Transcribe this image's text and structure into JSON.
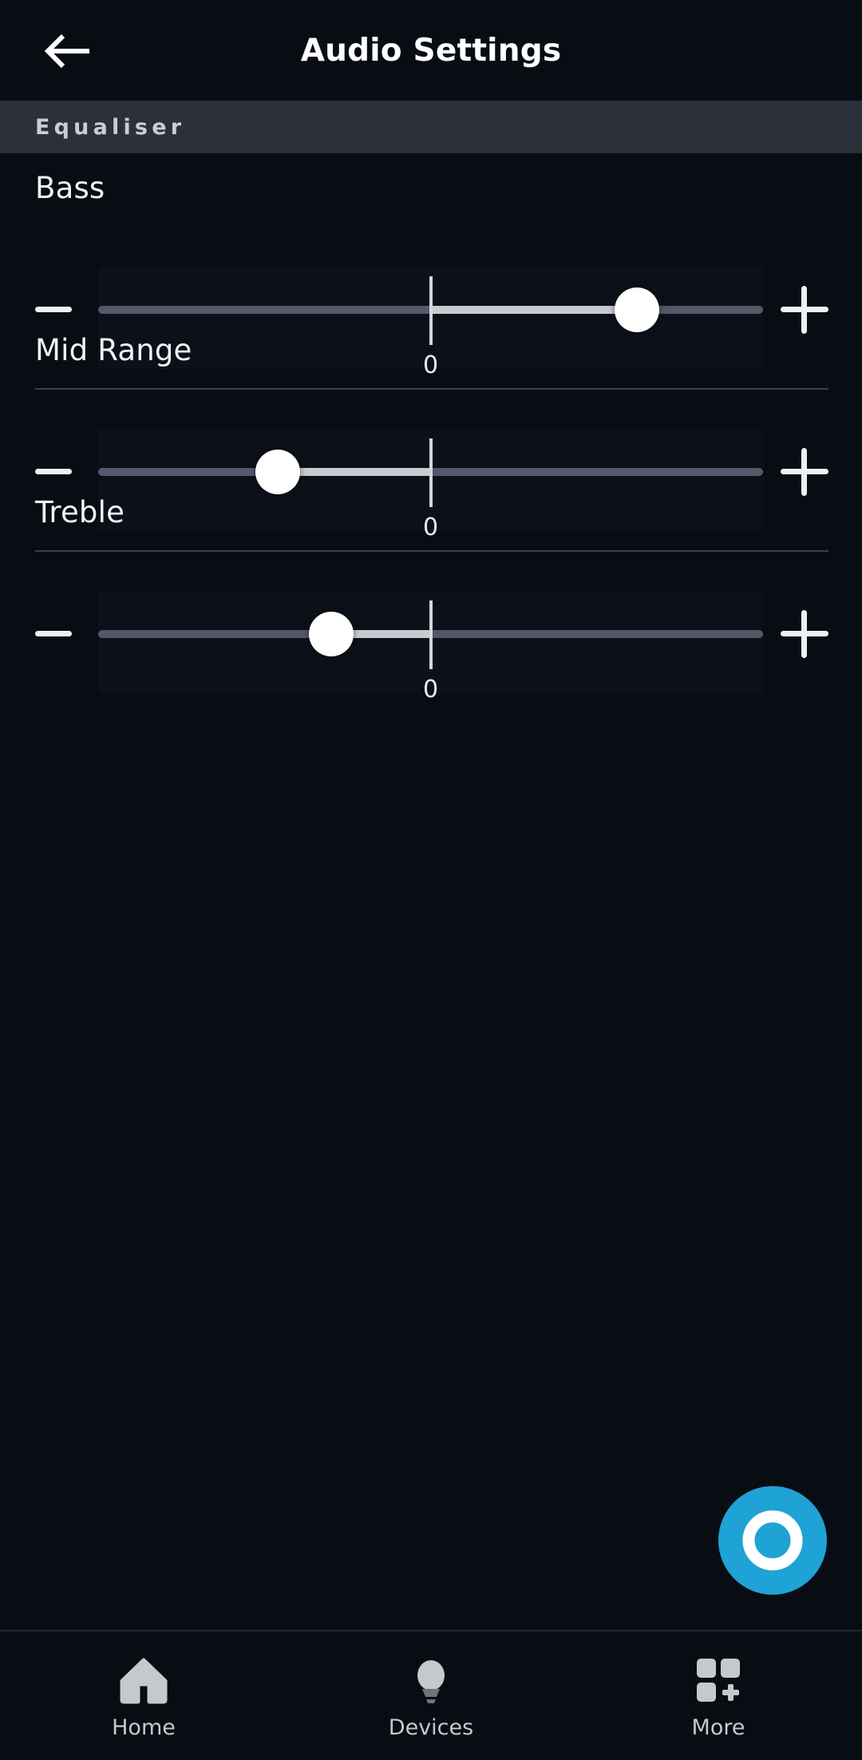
{
  "appbar": {
    "title": "Audio Settings",
    "back_icon": "arrow-left-icon"
  },
  "section": {
    "label": "Equaliser"
  },
  "equalizer": {
    "decrease_icon": "minus-icon",
    "increase_icon": "plus-icon",
    "bands": [
      {
        "label": "Bass",
        "value": "0",
        "center_label": "0",
        "thumb_percent": 81,
        "center_percent": 50,
        "has_divider": true
      },
      {
        "label": "Mid Range",
        "value": "0",
        "center_label": "0",
        "thumb_percent": 27,
        "center_percent": 50,
        "has_divider": true
      },
      {
        "label": "Treble",
        "value": "0",
        "center_label": "0",
        "thumb_percent": 35,
        "center_percent": 50,
        "has_divider": false
      }
    ]
  },
  "fab": {
    "icon": "alexa-icon",
    "color": "#1fa2d6"
  },
  "bottom_nav": {
    "items": [
      {
        "label": "Home",
        "icon": "home-icon"
      },
      {
        "label": "Devices",
        "icon": "lightbulb-icon"
      },
      {
        "label": "More",
        "icon": "grid-plus-icon"
      }
    ]
  },
  "colors": {
    "background": "#080d14",
    "section_bar": "#2b303a",
    "track_inactive": "#55586a",
    "track_active": "#c9cacf",
    "thumb": "#ffffff",
    "accent": "#1fa2d6",
    "nav_icon": "#c5c9ce"
  }
}
